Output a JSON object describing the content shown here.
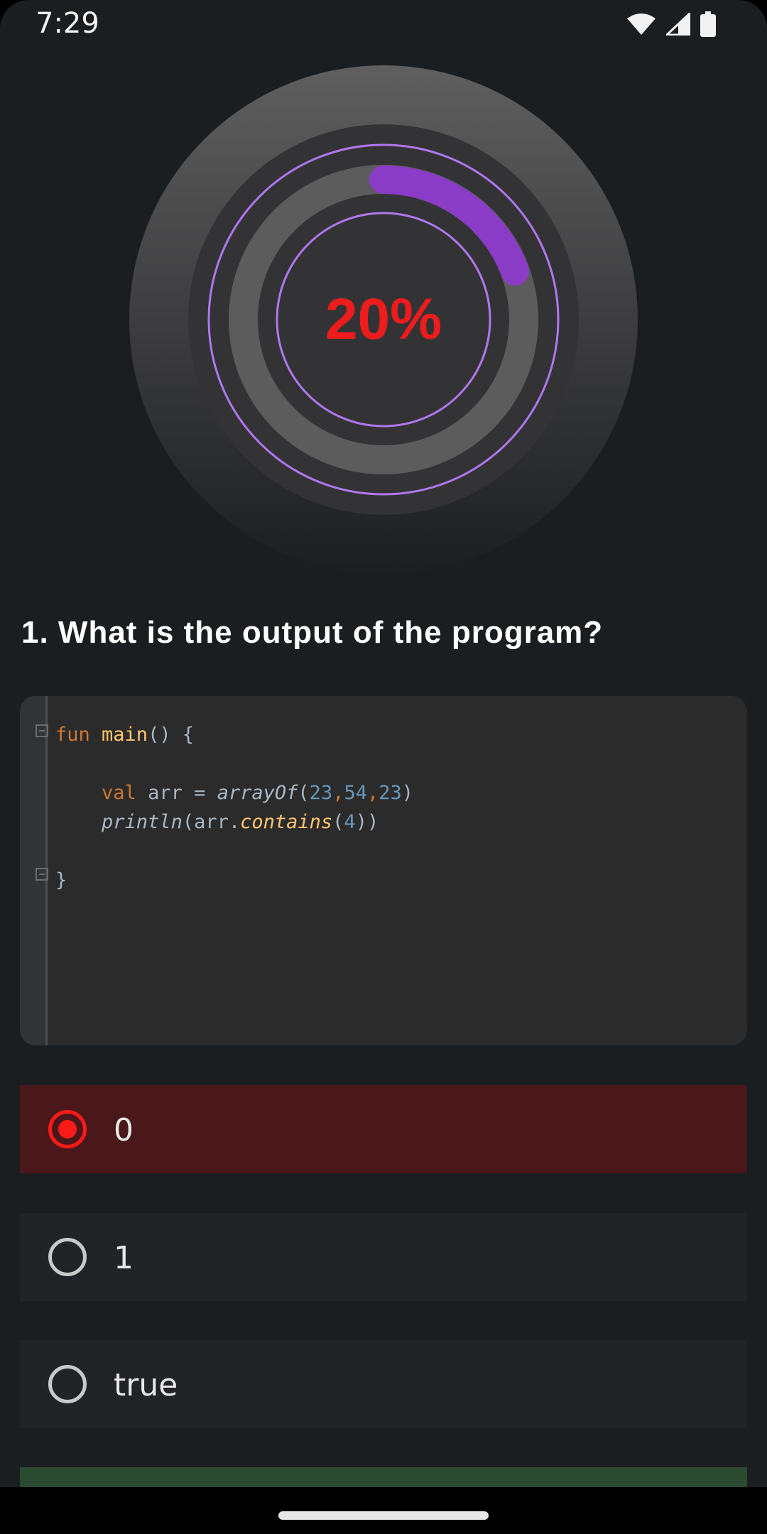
{
  "status_bar": {
    "time": "7:29",
    "icons": [
      "wifi-icon",
      "signal-icon",
      "battery-icon"
    ]
  },
  "progress": {
    "label": "20%",
    "value": 0.2,
    "arc_color": "#8a3cc7",
    "label_color": "#ee1c1c"
  },
  "question": {
    "text": "1. What is the output of the program?"
  },
  "code": {
    "language": "kotlin",
    "lines": [
      "fun main() {",
      "",
      "    val arr = arrayOf(23,54,23)",
      "    println(arr.contains(4))",
      "",
      "}"
    ]
  },
  "options": [
    {
      "label": "0",
      "selected": true,
      "state": "wrong"
    },
    {
      "label": "1",
      "selected": false
    },
    {
      "label": "true",
      "selected": false
    }
  ],
  "colors": {
    "background": "#1b1e21",
    "wrong_bg": "#4a171b",
    "option_bg": "#222326",
    "submit_bg": "#2a4b2f"
  }
}
